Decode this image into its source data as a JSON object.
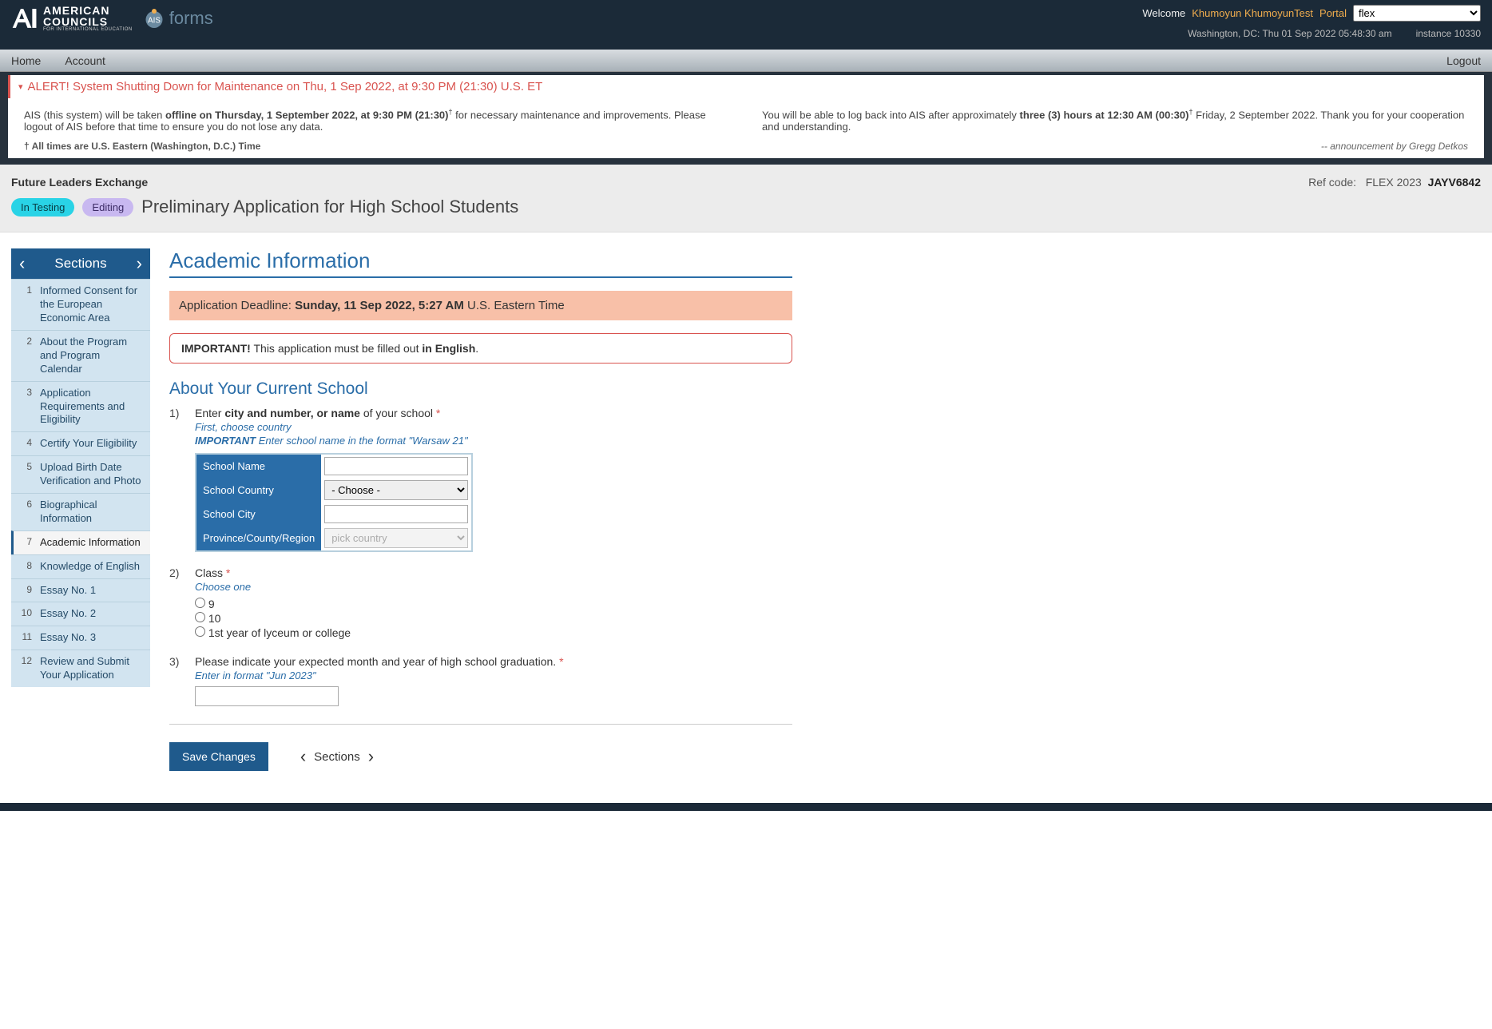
{
  "header": {
    "welcome_label": "Welcome",
    "username": "Khumoyun KhumoyunTest",
    "portal_label": "Portal",
    "portal_selected": "flex",
    "location_time": "Washington, DC: Thu 01 Sep 2022 05:48:30 am",
    "instance": "instance 10330"
  },
  "nav": {
    "home": "Home",
    "account": "Account",
    "logout": "Logout"
  },
  "alert": {
    "title": "ALERT! System Shutting Down for Maintenance on Thu, 1 Sep 2022, at 9:30 PM (21:30) U.S. ET",
    "col1_pre": "AIS (this system) will be taken ",
    "col1_bold": "offline on Thursday, 1 September 2022, at 9:30 PM (21:30)",
    "col1_post": " for necessary maintenance and improvements. Please logout of AIS before that time to ensure you do not lose any data.",
    "col2_pre": "You will be able to log back into AIS after approximately ",
    "col2_bold": "three (3) hours at 12:30 AM (00:30)",
    "col2_post": " Friday, 2 September 2022. Thank you for your cooperation and understanding.",
    "tz_note": "† All times are U.S. Eastern (Washington, D.C.) Time",
    "by": "-- announcement by Gregg Detkos"
  },
  "page_header": {
    "program": "Future Leaders Exchange",
    "ref_label": "Ref code:",
    "ref_year": "FLEX 2023",
    "ref_code": "JAYV6842",
    "badge_testing": "In Testing",
    "badge_editing": "Editing",
    "form_title": "Preliminary Application for High School Students"
  },
  "section_nav": {
    "title": "Sections",
    "items": [
      {
        "num": "1",
        "label": "Informed Consent for the European Economic Area"
      },
      {
        "num": "2",
        "label": "About the Program and Program Calendar"
      },
      {
        "num": "3",
        "label": "Application Requirements and Eligibility"
      },
      {
        "num": "4",
        "label": "Certify Your Eligibility"
      },
      {
        "num": "5",
        "label": "Upload Birth Date Verification and Photo"
      },
      {
        "num": "6",
        "label": "Biographical Information"
      },
      {
        "num": "7",
        "label": "Academic Information"
      },
      {
        "num": "8",
        "label": "Knowledge of English"
      },
      {
        "num": "9",
        "label": "Essay No. 1"
      },
      {
        "num": "10",
        "label": "Essay No. 2"
      },
      {
        "num": "11",
        "label": "Essay No. 3"
      },
      {
        "num": "12",
        "label": "Review and Submit Your Application"
      }
    ],
    "active_index": 6
  },
  "content": {
    "section_title": "Academic Information",
    "deadline_pre": "Application Deadline: ",
    "deadline_bold": "Sunday, 11 Sep 2022, 5:27 AM",
    "deadline_post": " U.S. Eastern Time",
    "important_label": "IMPORTANT!",
    "important_text": " This application must be filled out ",
    "important_bold": "in English",
    "sub_title": "About Your Current School",
    "q1": {
      "num": "1)",
      "text_pre": "Enter ",
      "text_bold": "city and number, or name",
      "text_post": " of your school",
      "hint1": "First, choose country",
      "hint2_label": "IMPORTANT",
      "hint2_text": " Enter school name in the format \"Warsaw 21\"",
      "fields": {
        "school_name_label": "School Name",
        "school_country_label": "School Country",
        "school_country_choose": "- Choose -",
        "school_city_label": "School City",
        "region_label": "Province/County/Region",
        "region_placeholder": "pick country"
      }
    },
    "q2": {
      "num": "2)",
      "text": "Class",
      "hint": "Choose one",
      "options": [
        "9",
        "10",
        "1st year of lyceum or college"
      ]
    },
    "q3": {
      "num": "3)",
      "text": "Please indicate your expected month and year of high school graduation.",
      "hint": "Enter in format \"Jun 2023\""
    },
    "save_btn": "Save Changes",
    "sections_label": "Sections"
  }
}
